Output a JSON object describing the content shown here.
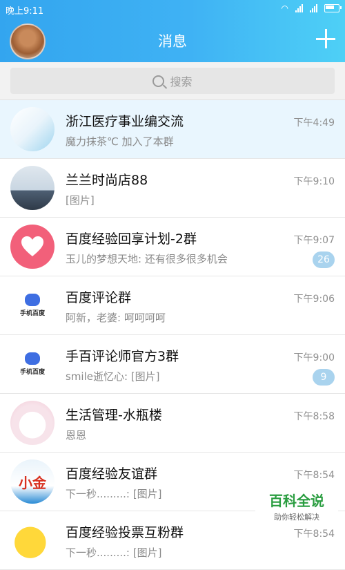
{
  "status_bar": {
    "time": "晚上9:11"
  },
  "header": {
    "title": "消息"
  },
  "search": {
    "placeholder": "搜索"
  },
  "conversations": [
    {
      "name": "浙江医疗事业编交流",
      "preview": "魔力抹茶℃ 加入了本群",
      "time": "下午4:49",
      "badge": ""
    },
    {
      "name": "兰兰时尚店88",
      "preview": "[图片]",
      "time": "下午9:10",
      "badge": ""
    },
    {
      "name": "百度经验回享计划-2群",
      "preview": "玉儿的梦想天地: 还有很多很多机会",
      "time": "下午9:07",
      "badge": "26"
    },
    {
      "name": "百度评论群",
      "preview": "阿新，老婆: 呵呵呵呵",
      "time": "下午9:06",
      "badge": ""
    },
    {
      "name": "手百评论师官方3群",
      "preview": "smile逝忆心: [图片]",
      "time": "下午9:00",
      "badge": "9"
    },
    {
      "name": "生活管理-水瓶楼",
      "preview": "恩恩",
      "time": "下午8:58",
      "badge": ""
    },
    {
      "name": "百度经验友谊群",
      "preview": "下一秒.........: [图片]",
      "time": "下午8:54",
      "badge": ""
    },
    {
      "name": "百度经验投票互粉群",
      "preview": "下一秒.........: [图片]",
      "time": "下午8:54",
      "badge": ""
    }
  ],
  "avatars": {
    "baidu_label": "手机百度",
    "xiao_text": "小金"
  },
  "watermark": {
    "title": "百科全说",
    "subtitle": "助你轻松解决"
  },
  "colors": {
    "header_start": "#33a5ef",
    "header_end": "#4ed0f6",
    "badge": "#a9d3ee",
    "active_row": "#e9f6fe"
  },
  "icons": {
    "add": "plus-icon",
    "search": "search-icon"
  }
}
